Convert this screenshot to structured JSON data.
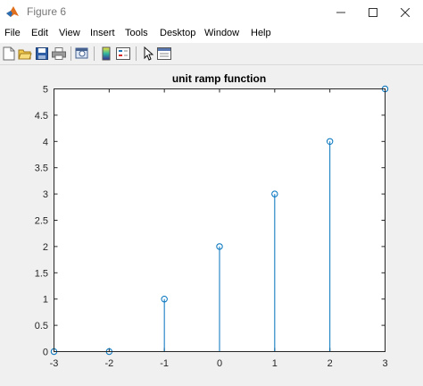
{
  "window": {
    "title": "Figure 6",
    "controls": [
      "minimize",
      "maximize",
      "close"
    ]
  },
  "menu": {
    "items": [
      "File",
      "Edit",
      "View",
      "Insert",
      "Tools",
      "Desktop",
      "Window",
      "Help"
    ]
  },
  "toolbar": {
    "icons": [
      "new-figure-icon",
      "open-file-icon",
      "save-icon",
      "print-icon",
      "zoom-figure-icon",
      "colorbar-icon",
      "legend-icon",
      "select-arrow-icon",
      "property-editor-icon"
    ]
  },
  "chart_data": {
    "type": "stem",
    "title": "unit ramp function",
    "xlabel": "",
    "ylabel": "",
    "x": [
      -3,
      -2,
      -1,
      0,
      1,
      2,
      3
    ],
    "y": [
      0,
      0,
      1,
      2,
      3,
      4,
      5
    ],
    "xlim": [
      -3,
      3
    ],
    "ylim": [
      0,
      5
    ],
    "xticks": [
      "-3",
      "-2",
      "-1",
      "0",
      "1",
      "2",
      "3"
    ],
    "yticks": [
      "0",
      "0.5",
      "1",
      "1.5",
      "2",
      "2.5",
      "3",
      "3.5",
      "4",
      "4.5",
      "5"
    ],
    "grid": false,
    "color": "#0072bd",
    "marker": "circle"
  }
}
